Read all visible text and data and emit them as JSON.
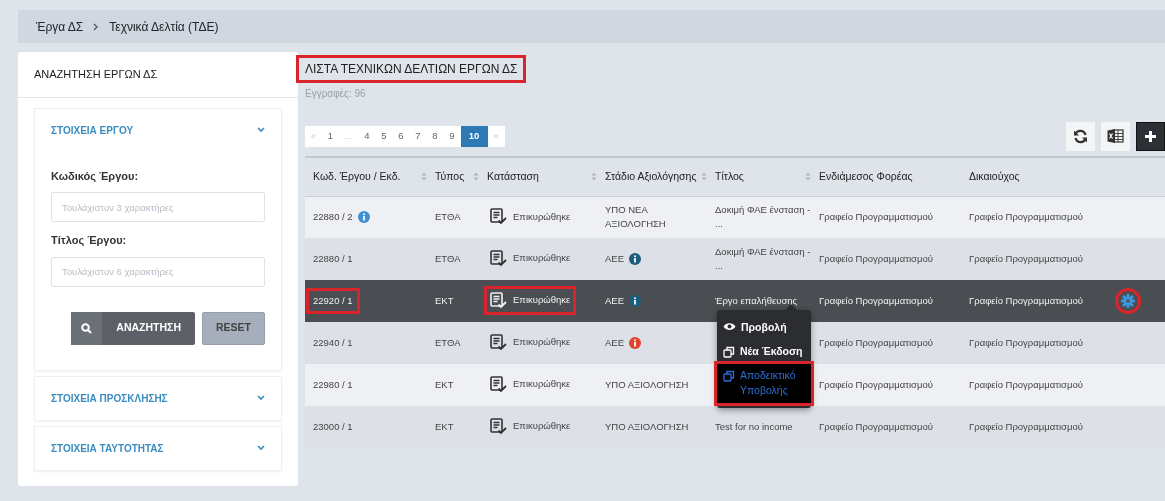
{
  "breadcrumb": [
    "Έργα ΔΣ",
    "Τεχνικά Δελτία (ΤΔΕ)"
  ],
  "search_panel": {
    "title": "ΑΝΑΖΗΤΗΣΗ ΕΡΓΩΝ ΔΣ",
    "sections": [
      {
        "title": "ΣΤΟΙΧΕΙΑ ΕΡΓΟΥ",
        "expanded": true,
        "fields": [
          {
            "label": "Κωδικός Έργου:",
            "placeholder": "Τουλάχιστον 3 χαρακτήρες"
          },
          {
            "label": "Τίτλος Έργου:",
            "placeholder": "Τουλάχιστον 6 χαρακτήρες"
          }
        ],
        "buttons": [
          {
            "label": "ΑΝΑΖΗΤΗΣΗ",
            "kind": "search"
          },
          {
            "label": "RESET",
            "kind": "reset"
          }
        ]
      },
      {
        "title": "ΣΤΟΙΧΕΙΑ ΠΡΟΣΚΛΗΣΗΣ",
        "expanded": false
      },
      {
        "title": "ΣΤΟΙΧΕΙΑ ΤΑΥΤΟΤΗΤΑΣ",
        "expanded": false
      }
    ]
  },
  "list": {
    "title": "ΛΙΣΤΑ ΤΕΧΝΙΚΩΝ ΔΕΛΤΙΩΝ ΕΡΓΩΝ ΔΣ",
    "title_highlighted": true,
    "records": "Εγγραφές: 96",
    "pagination": [
      {
        "label": "«",
        "selected": false,
        "disabled": true
      },
      {
        "label": "1",
        "selected": false,
        "disabled": false
      },
      {
        "label": "…",
        "selected": false,
        "disabled": true
      },
      {
        "label": "4",
        "selected": false,
        "disabled": false
      },
      {
        "label": "5",
        "selected": false,
        "disabled": false
      },
      {
        "label": "6",
        "selected": false,
        "disabled": false
      },
      {
        "label": "7",
        "selected": false,
        "disabled": false
      },
      {
        "label": "8",
        "selected": false,
        "disabled": false
      },
      {
        "label": "9",
        "selected": false,
        "disabled": false
      },
      {
        "label": "10",
        "selected": true,
        "disabled": false
      },
      {
        "label": "»",
        "selected": false,
        "disabled": true
      }
    ],
    "toolbar": [
      {
        "kind": "refresh"
      },
      {
        "kind": "excel"
      },
      {
        "kind": "add"
      }
    ],
    "table": {
      "columns": [
        {
          "label": "Κωδ. Έργου / Εκδ.",
          "sortable": true
        },
        {
          "label": "Τύπος",
          "sortable": true
        },
        {
          "label": "Κατάσταση",
          "sortable": true
        },
        {
          "label": "Στάδιο Αξιολόγησης",
          "sortable": true
        },
        {
          "label": "Τίτλος",
          "sortable": true
        },
        {
          "label": "Ενδιάμεσος Φορέας",
          "sortable": false
        },
        {
          "label": "Δικαιούχος",
          "sortable": false
        }
      ],
      "rows": [
        {
          "selected": false,
          "code": "22880 / 2",
          "code_info": {
            "color": "#3d8fd6"
          },
          "type": "ΕΤΘΑ",
          "status": "Επικυρώθηκε",
          "stage": "ΥΠΟ ΝΕΑ ΑΞΙΟΛΟΓΗΣΗ",
          "title": "Δοκιμή ΦΑΕ ένσταση - ...",
          "body": "Γραφείο Προγραμματισμού",
          "beneficiary": "Γραφείο Προγραμματισμού"
        },
        {
          "selected": false,
          "code": "22880 / 1",
          "type": "ΕΤΘΑ",
          "status": "Επικυρώθηκε",
          "stage": "ΑΕΕ",
          "stage_info": {
            "color": "#1b5e7e"
          },
          "title": "Δοκιμή ΦΑΕ ένσταση - ...",
          "body": "Γραφείο Προγραμματισμού",
          "beneficiary": "Γραφείο Προγραμματισμού"
        },
        {
          "selected": true,
          "code": "22920 / 1",
          "code_highlighted": true,
          "type": "ΕΚΤ",
          "status": "Επικυρώθηκε",
          "status_highlighted": true,
          "stage": "ΑΕΕ",
          "stage_info": {
            "color": "#1b5e7e"
          },
          "title": "Έργο επαλήθευσης",
          "body": "Γραφείο Προγραμματισμού",
          "beneficiary": "Γραφείο Προγραμματισμού",
          "actions_highlighted": true
        },
        {
          "selected": false,
          "code": "22940 / 1",
          "type": "ΕΤΘΑ",
          "status": "Επικυρώθηκε",
          "stage": "ΑΕΕ",
          "stage_info": {
            "color": "#e0452b"
          },
          "body": "Γραφείο Προγραμματισμού",
          "beneficiary": "Γραφείο Προγραμματισμού"
        },
        {
          "selected": false,
          "code": "22980 / 1",
          "type": "ΕΚΤ",
          "status": "Επικυρώθηκε",
          "stage": "ΥΠΟ ΑΞΙΟΛΟΓΗΣΗ",
          "body": "Γραφείο Προγραμματισμού",
          "beneficiary": "Γραφείο Προγραμματισμού"
        },
        {
          "selected": false,
          "code": "23000 / 1",
          "type": "ΕΚΤ",
          "status": "Επικυρώθηκε",
          "stage": "ΥΠΟ ΑΞΙΟΛΟΓΗΣΗ",
          "title": "Test for no income",
          "body": "Γραφείο Προγραμματισμού",
          "beneficiary": "Γραφείο Προγραμματισμού"
        }
      ]
    },
    "action_menu": [
      {
        "label": "Προβολή",
        "kind": "view",
        "selected": false,
        "highlighted": false
      },
      {
        "label": "Νέα Έκδοση",
        "kind": "copy",
        "selected": false,
        "highlighted": false
      },
      {
        "label": "Αποδεικτικό Υποβολής",
        "kind": "copy",
        "selected": true,
        "highlighted": true
      }
    ]
  }
}
